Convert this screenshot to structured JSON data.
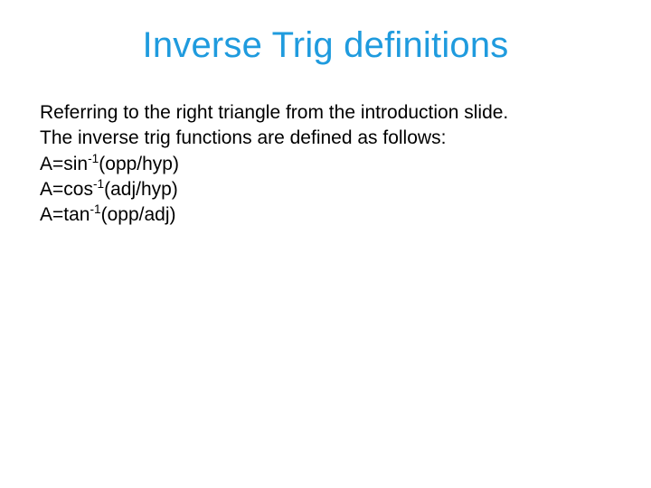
{
  "title": "Inverse Trig definitions",
  "body": {
    "line1": "Referring to the right triangle from the introduction slide.",
    "line2": "The inverse trig functions are defined as follows:",
    "eq1_lhs": "A=sin",
    "eq1_sup": "-1",
    "eq1_rhs": "(opp/hyp)",
    "eq2_lhs": "A=cos",
    "eq2_sup": "-1",
    "eq2_rhs": "(adj/hyp)",
    "eq3_lhs": "A=tan",
    "eq3_sup": "-1",
    "eq3_rhs": "(opp/adj)"
  }
}
